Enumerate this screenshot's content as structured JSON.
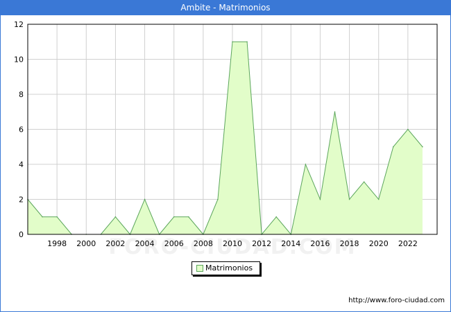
{
  "header": {
    "title": "Ambite - Matrimonios"
  },
  "source_url": "http://www.foro-ciudad.com",
  "watermark": "FORO-CIUDAD.COM",
  "colors": {
    "header_bg": "#3a78d6",
    "area_fill": "#e2fdc9",
    "area_line": "#5ca65c",
    "grid": "#d0d0d0"
  },
  "chart_data": {
    "type": "area",
    "title": "Ambite - Matrimonios",
    "xlabel": "",
    "ylabel": "",
    "x": [
      1996,
      1997,
      1998,
      1999,
      2000,
      2001,
      2002,
      2003,
      2004,
      2005,
      2006,
      2007,
      2008,
      2009,
      2010,
      2011,
      2012,
      2013,
      2014,
      2015,
      2016,
      2017,
      2018,
      2019,
      2020,
      2021,
      2022,
      2023
    ],
    "series": [
      {
        "name": "Matrimonios",
        "values": [
          2,
          1,
          1,
          0,
          0,
          0,
          1,
          0,
          2,
          0,
          1,
          1,
          0,
          2,
          11,
          11,
          0,
          1,
          0,
          4,
          2,
          7,
          2,
          3,
          2,
          5,
          6,
          5
        ]
      }
    ],
    "xlim": [
      1996,
      2024
    ],
    "ylim": [
      0,
      12
    ],
    "x_ticks": [
      1998,
      2000,
      2002,
      2004,
      2006,
      2008,
      2010,
      2012,
      2014,
      2016,
      2018,
      2020,
      2022
    ],
    "y_ticks": [
      0,
      2,
      4,
      6,
      8,
      10,
      12
    ],
    "grid": true,
    "legend": "bottom-center"
  }
}
